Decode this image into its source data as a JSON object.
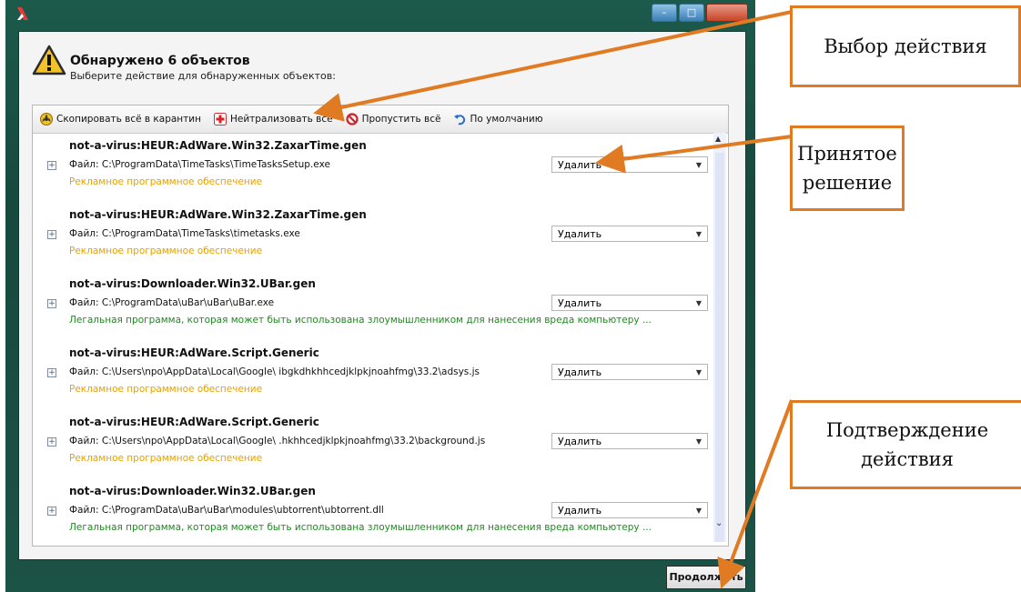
{
  "window": {
    "title": "Обнаружено 6 объектов",
    "subtitle": "Выберите действие для обнаруженных объектов:",
    "controls": {
      "minimize": "–",
      "maximize": "□",
      "close": ""
    }
  },
  "toolbar": {
    "quarantine_all": "Скопировать всё в карантин",
    "neutralize_all": "Нейтрализовать всё",
    "skip_all": "Пропустить всё",
    "default": "По умолчанию"
  },
  "detections": [
    {
      "name": "not-a-virus:HEUR:AdWare.Win32.ZaxarTime.gen",
      "file": "Файл: C:\\ProgramData\\TimeTasks\\TimeTasksSetup.exe",
      "action": "Удалить",
      "description": "Рекламное программное обеспечение",
      "description_color": "#e8a100"
    },
    {
      "name": "not-a-virus:HEUR:AdWare.Win32.ZaxarTime.gen",
      "file": "Файл: C:\\ProgramData\\TimeTasks\\timetasks.exe",
      "action": "Удалить",
      "description": "Рекламное программное обеспечение",
      "description_color": "#e8a100"
    },
    {
      "name": "not-a-virus:Downloader.Win32.UBar.gen",
      "file": "Файл: C:\\ProgramData\\uBar\\uBar\\uBar.exe",
      "action": "Удалить",
      "description": "Легальная программа, которая может быть использована злоумышленником для нанесения вреда компьютеру ...",
      "description_color": "#1f8a1f"
    },
    {
      "name": "not-a-virus:HEUR:AdWare.Script.Generic",
      "file": "Файл: C:\\Users\\npo\\AppData\\Local\\Google\\   ibgkdhkhhcedjklpkjnoahfmg\\33.2\\adsys.js",
      "action": "Удалить",
      "description": "Рекламное программное обеспечение",
      "description_color": "#e8a100"
    },
    {
      "name": "not-a-virus:HEUR:AdWare.Script.Generic",
      "file": "Файл: C:\\Users\\npo\\AppData\\Local\\Google\\  .hkhhcedjklpkjnoahfmg\\33.2\\background.js",
      "action": "Удалить",
      "description": "Рекламное программное обеспечение",
      "description_color": "#e8a100"
    },
    {
      "name": "not-a-virus:Downloader.Win32.UBar.gen",
      "file": "Файл: C:\\ProgramData\\uBar\\uBar\\modules\\ubtorrent\\ubtorrent.dll",
      "action": "Удалить",
      "description": "Легальная программа, которая может быть использована злоумышленником для нанесения вреда компьютеру ...",
      "description_color": "#1f8a1f"
    }
  ],
  "buttons": {
    "continue": "Продолжить"
  },
  "annotations": {
    "choose_action": "Выбор действия",
    "decision": "Принятое решение",
    "confirm": "Подтверждение действия"
  },
  "colors": {
    "frame": "#17493e",
    "annotation": "#e07b24"
  }
}
